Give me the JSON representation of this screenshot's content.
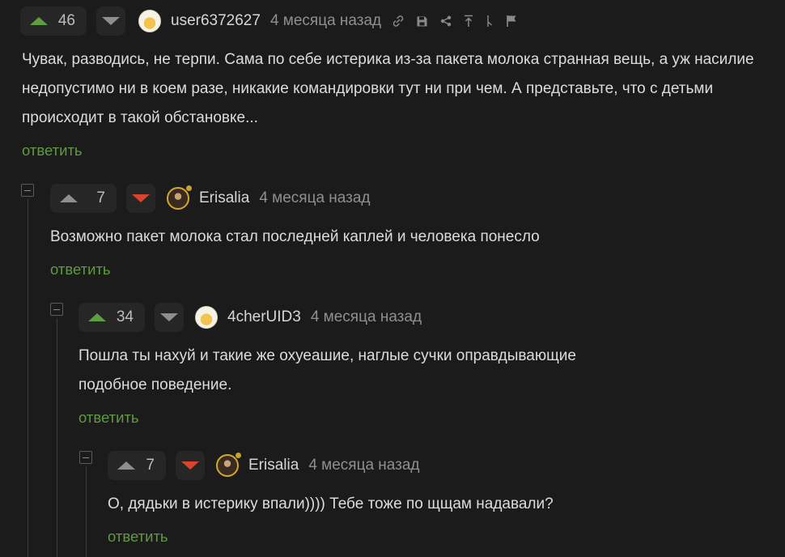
{
  "comments": [
    {
      "rating": "46",
      "vote_state": "up",
      "username": "user6372627",
      "time": "4 месяца назад",
      "avatar": "beer-avatar",
      "text": "Чувак, разводись, не терпи. Сама по себе истерика из-за пакета молока странная вещь, а уж насилие недопустимо ни в коем разе, никакие командировки тут ни при чем. А представьте, что с детьми происходит в такой обстановке...",
      "reply_label": "ответить",
      "toolbar_icons": [
        "link-icon",
        "save-icon",
        "share-icon",
        "go-to-parent-icon",
        "branch-icon",
        "report-flag-icon"
      ]
    },
    {
      "rating": "7",
      "vote_state": "down",
      "username": "Erisalia",
      "time": "4 месяца назад",
      "avatar": "photo-avatar",
      "text": "Возможно пакет молока стал последней каплей и человека понесло",
      "reply_label": "ответить"
    },
    {
      "rating": "34",
      "vote_state": "up",
      "username": "4cherUID3",
      "time": "4 месяца назад",
      "avatar": "beer-avatar",
      "text": "Пошла ты нахуй и такие же охуеашие, наглые сучки оправдывающие подобное поведение.",
      "reply_label": "ответить"
    },
    {
      "rating": "7",
      "vote_state": "down",
      "username": "Erisalia",
      "time": "4 месяца назад",
      "avatar": "photo-avatar",
      "text": "О, дядьки в истерику впали)))) Тебе тоже по щщам надавали?",
      "reply_label": "ответить"
    }
  ],
  "colors": {
    "background": "#1b1b1b",
    "upvote_active": "#5d9e43",
    "downvote_active": "#d9442f",
    "reply_link": "#5f9a41",
    "online_dot": "#c9a22c"
  }
}
